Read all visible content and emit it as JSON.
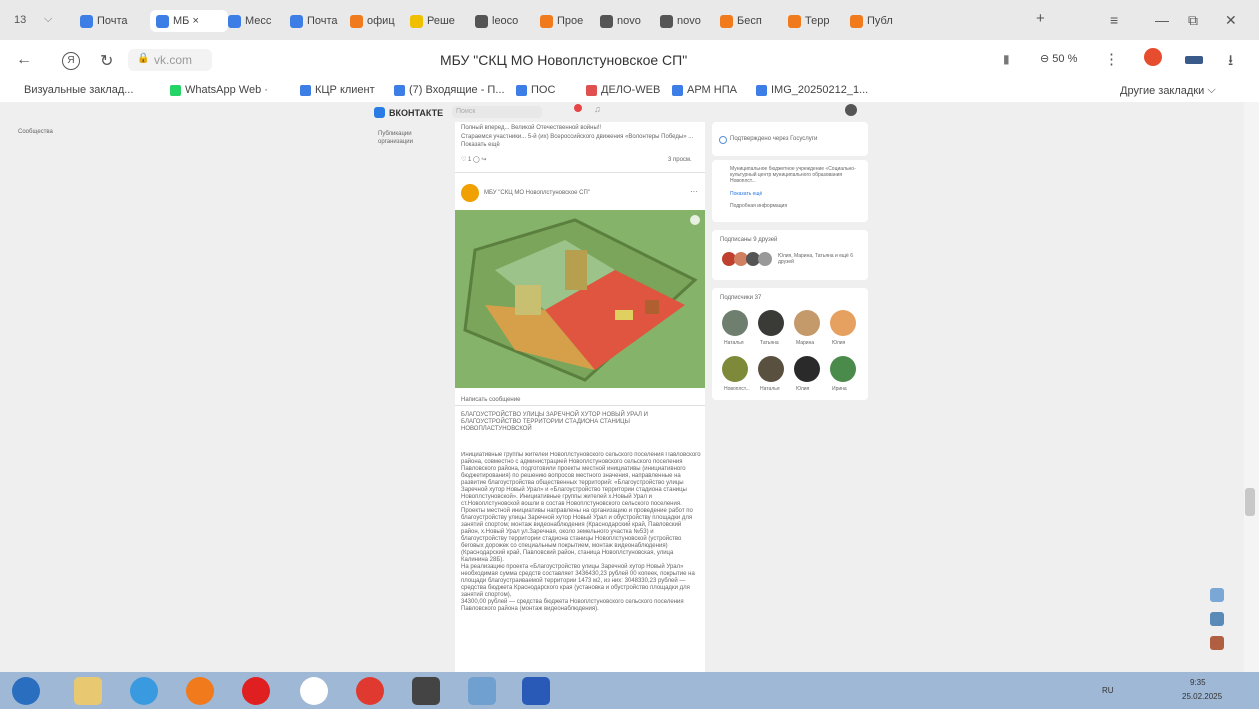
{
  "tabbar": {
    "count": "13",
    "tabs": [
      {
        "label": "Почта",
        "color": "#3d7ee6"
      },
      {
        "label": "МБ ×",
        "color": "#3d7ee6"
      },
      {
        "label": "Месс",
        "color": "#3d7ee6"
      },
      {
        "label": "Почта",
        "color": "#3d7ee6"
      },
      {
        "label": "офиц",
        "color": "#f07a1c"
      },
      {
        "label": "Реше",
        "color": "#f0c000"
      },
      {
        "label": "leoco",
        "color": "#555555"
      },
      {
        "label": "Прое",
        "color": "#f07a1c"
      },
      {
        "label": "novo",
        "color": "#555555"
      },
      {
        "label": "novo",
        "color": "#555555"
      },
      {
        "label": "Бесп",
        "color": "#f07a1c"
      },
      {
        "label": "Терр",
        "color": "#f07a1c"
      },
      {
        "label": "Публ",
        "color": "#f07a1c"
      }
    ],
    "new_tab": "+",
    "menu_icon": "≡",
    "minimize": "—",
    "maximize": "⧉",
    "close": "✕"
  },
  "address": {
    "back": "←",
    "yandex": "Я",
    "reload": "↻",
    "url": "vk.com",
    "title": "МБУ \"СКЦ МО Новоплстуновское СП\"",
    "zoom": "50 %",
    "more": "⋮",
    "download": "⭳"
  },
  "bookmarks": {
    "items": [
      {
        "label": "Визуальные заклад...",
        "color": "#ffffff"
      },
      {
        "label": "WhatsApp Web ·",
        "color": "#25d366"
      },
      {
        "label": "КЦР клиент",
        "color": "#3d7ee6"
      },
      {
        "label": "(7) Входящие - П...",
        "color": "#3d7ee6"
      },
      {
        "label": "ПОС",
        "color": "#3d7ee6"
      },
      {
        "label": "ДЕЛО-WEB",
        "color": "#e05050"
      },
      {
        "label": "АРМ НПА",
        "color": "#3d7ee6"
      },
      {
        "label": "IMG_20250212_1...",
        "color": "#3d7ee6"
      }
    ],
    "other": "Другие закладки"
  },
  "vk": {
    "logo": "ВКОНТАКТЕ",
    "search": "Поиск",
    "post_top": "Полный вперед... Великой Отечественной войны!!",
    "post_top2": "Стараемся участники... 5-й (их) Всероссийского движения «Волонтеры Победы»  ... Показать ещё",
    "likes": "♡ 1  ◯  ↪",
    "views": "3 просм.",
    "post_author": "МБУ \"СКЦ МО Новоплстуновское СП\"",
    "write_msg": "Написать сообщение",
    "post_title": "БЛАГОУСТРОЙСТВО УЛИЦЫ ЗАРЕЧНОЙ ХУТОР НОВЫЙ УРАЛ И БЛАГОУСТРОЙСТВО ТЕРРИТОРИИ СТАДИОНА СТАНИЦЫ НОВОПЛАСТУНОВСКОЙ",
    "post_body": [
      "Инициативные группы жителей Новоплстуновского сельского поселения Павловского района, совместно с администрацией Новоплстуновского сельского поселения Павловского района, подготовили проекты местной инициативы (инициативного бюджетирования) по решению вопросов местного значения, направленные на развитие благоустройства общественных территорий: «Благоустройство улицы Заречной хутор Новый Урал» и «Благоустройство территории стадиона станицы Новоплстуновской». Инициативные группы жителей х.Новый Урал и ст.Новоплстуновской вошли в состав Новоплстуновского сельского поселения. Проекты местной инициативы направлены на организацию и проведение работ по благоустройству улицы Заречной хутор Новый Урал и обустройству площадки для занятий спортом; монтаж видеонаблюдения (Краснодарский край, Павловский район, х.Новый Урал ул.Заречная, около земельного участка №53) и благоустройству территории стадиона станицы Новоплстуновской (устройство беговых дорожек со специальным покрытием, монтаж видеонаблюдения) (Краснодарский край, Павловский район, станица Новоплстуновская, улица Калинина 28Б).",
      "На реализацию проекта «Благоустройство улицы Заречной хутор Новый Урал» необходимая сумма средств составляет 3436430,23 рублей 00 копеек, покрытие на площади благоустраиваемой территории 1473 м2, из них: 3048330,23 рублей — средства бюджета Краснодарского края (установка и обустройство площадки для занятий спортом),",
      "34300,00 рублей — средства бюджета Новоплстуновского сельского поселения Павловского района (монтаж видеонаблюдения)."
    ],
    "side_confirm": "Подтверждено через Госуслуги",
    "side_org": "Муниципальное бюджетное учреждение «Социально-культурный центр муниципального образования Новоплст...",
    "side_more": "Показать ещё",
    "side_details": "Подробная информация",
    "friends_title": "Подписаны 9 друзей",
    "friends_names": "Юлия, Марина, Татьяна и ещё 6 друзей",
    "subs_title": "Подписчики 37",
    "subscribers": [
      {
        "name": "Наталья",
        "color": "#6f7f6f"
      },
      {
        "name": "Татьяна",
        "color": "#3a3a36"
      },
      {
        "name": "Марина",
        "color": "#c49a6a"
      },
      {
        "name": "Юлия",
        "color": "#e6a060"
      },
      {
        "name": "Новоплст...",
        "color": "#7e8a3a"
      },
      {
        "name": "Наталья",
        "color": "#5a5040"
      },
      {
        "name": "Юлия",
        "color": "#2a2a2a"
      },
      {
        "name": "Ирина",
        "color": "#4a8a4a"
      }
    ],
    "left_nav": "Сообщества",
    "left_desc": "Публикации организации"
  },
  "taskbar": {
    "lang": "RU",
    "time": "9:35",
    "date": "25.02.2025"
  }
}
